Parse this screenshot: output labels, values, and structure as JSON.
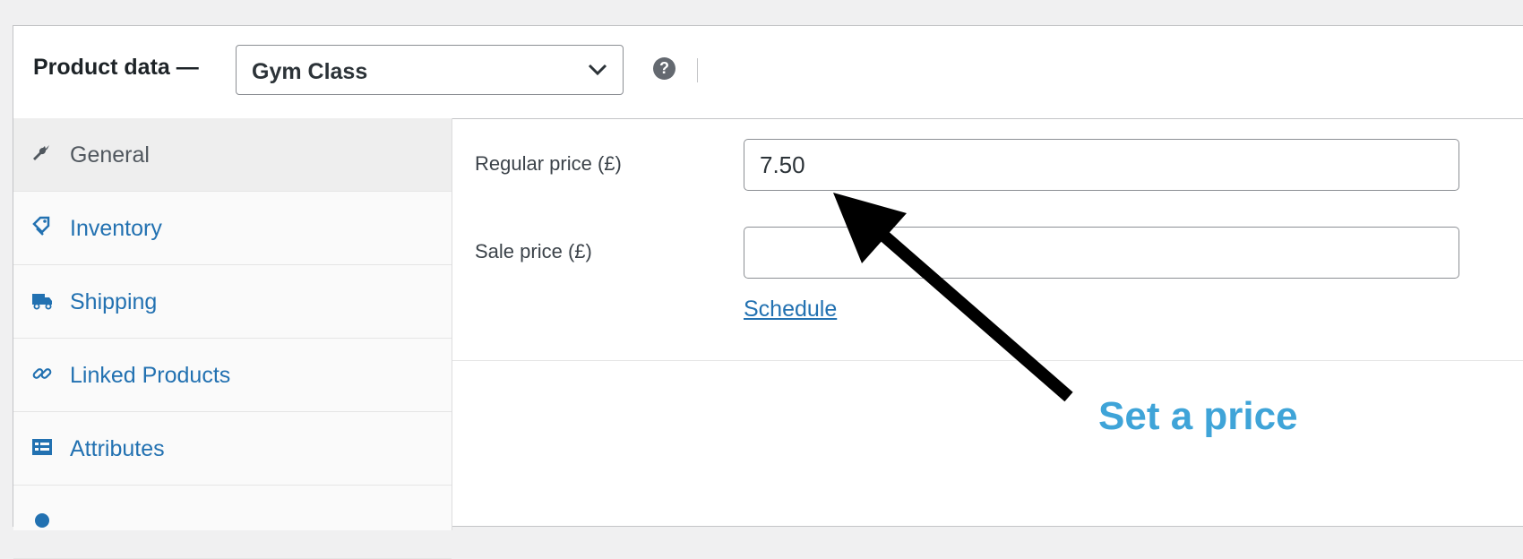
{
  "header": {
    "title": "Product data —",
    "product_type_value": "Gym Class"
  },
  "tabs": [
    {
      "label": "General",
      "icon": "wrench-icon",
      "active": true
    },
    {
      "label": "Inventory",
      "icon": "tag-icon",
      "active": false
    },
    {
      "label": "Shipping",
      "icon": "truck-icon",
      "active": false
    },
    {
      "label": "Linked Products",
      "icon": "link-icon",
      "active": false
    },
    {
      "label": "Attributes",
      "icon": "list-icon",
      "active": false
    }
  ],
  "general": {
    "regular_price_label": "Regular price (£)",
    "regular_price_value": "7.50",
    "sale_price_label": "Sale price (£)",
    "sale_price_value": "",
    "schedule_link": "Schedule"
  },
  "annotation": {
    "text": "Set a price"
  },
  "colors": {
    "link": "#2271b1",
    "annotation": "#3fa4d8",
    "background": "#f0f0f1"
  }
}
